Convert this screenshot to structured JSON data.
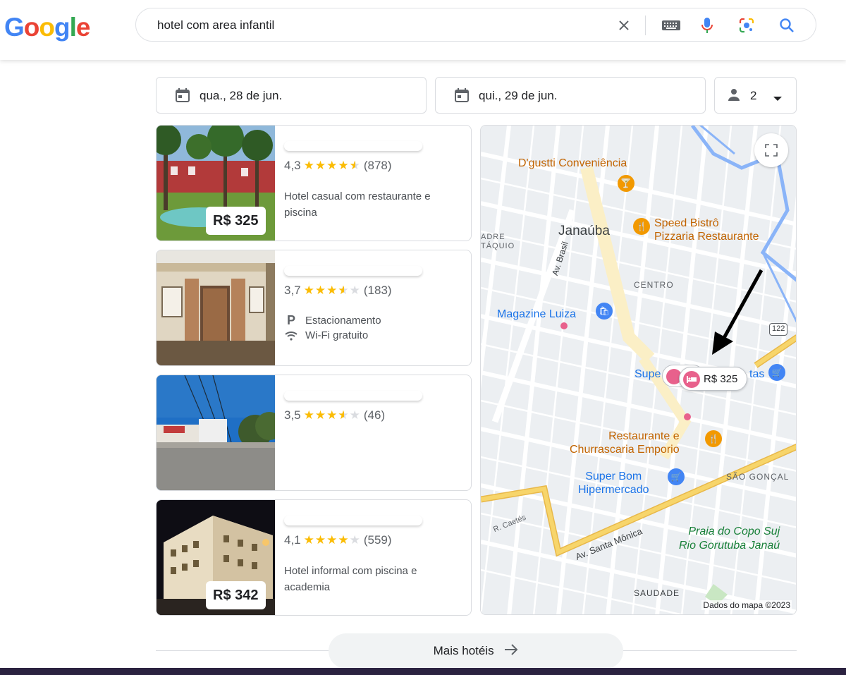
{
  "logo": "Google",
  "search": {
    "query": "hotel com area infantil"
  },
  "filters": {
    "checkin": "qua., 28 de jun.",
    "checkout": "qui., 29 de jun.",
    "guests": "2"
  },
  "hotels": [
    {
      "rating": "4,3",
      "stars": 4.5,
      "reviews": "(878)",
      "description": "Hotel casual com restaurante e piscina",
      "price": "R$ 325"
    },
    {
      "rating": "3,7",
      "stars": 3.5,
      "reviews": "(183)",
      "amenities": [
        "Estacionamento",
        "Wi-Fi gratuito"
      ]
    },
    {
      "rating": "3,5",
      "stars": 3.5,
      "reviews": "(46)"
    },
    {
      "rating": "4,1",
      "stars": 4,
      "reviews": "(559)",
      "description": "Hotel informal com piscina e academia",
      "price": "R$ 342"
    }
  ],
  "map": {
    "labels": {
      "dgustti": "D'gustti Conveniência",
      "speed1": "Speed Bistrô",
      "speed2": "Pizzaria Restaurante",
      "janauba": "Janaúba",
      "padre1": "ADRE",
      "padre2": "TÁQUIO",
      "avbrasil": "Av. Brasil",
      "centro": "CENTRO",
      "magazine": "Magazine Luiza",
      "super_left": "Supe",
      "super_right": "tas",
      "rest1": "Restaurante e",
      "rest2": "Churrascaria Emporio",
      "superbom1": "Super Bom",
      "superbom2": "Hipermercado",
      "saogoncalo": "SÃO GONÇAL",
      "rcaetes": "R. Caetés",
      "avsantamonica": "Av. Santa Mônica",
      "praia1": "Praia do Copo Suj",
      "praia2": "Rio Gorutuba Janaú",
      "saudade": "SAUDADE",
      "route": "122",
      "copyright": "Dados do mapa ©2023"
    },
    "pin_price": "R$ 325"
  },
  "more_hotels": "Mais hotéis"
}
